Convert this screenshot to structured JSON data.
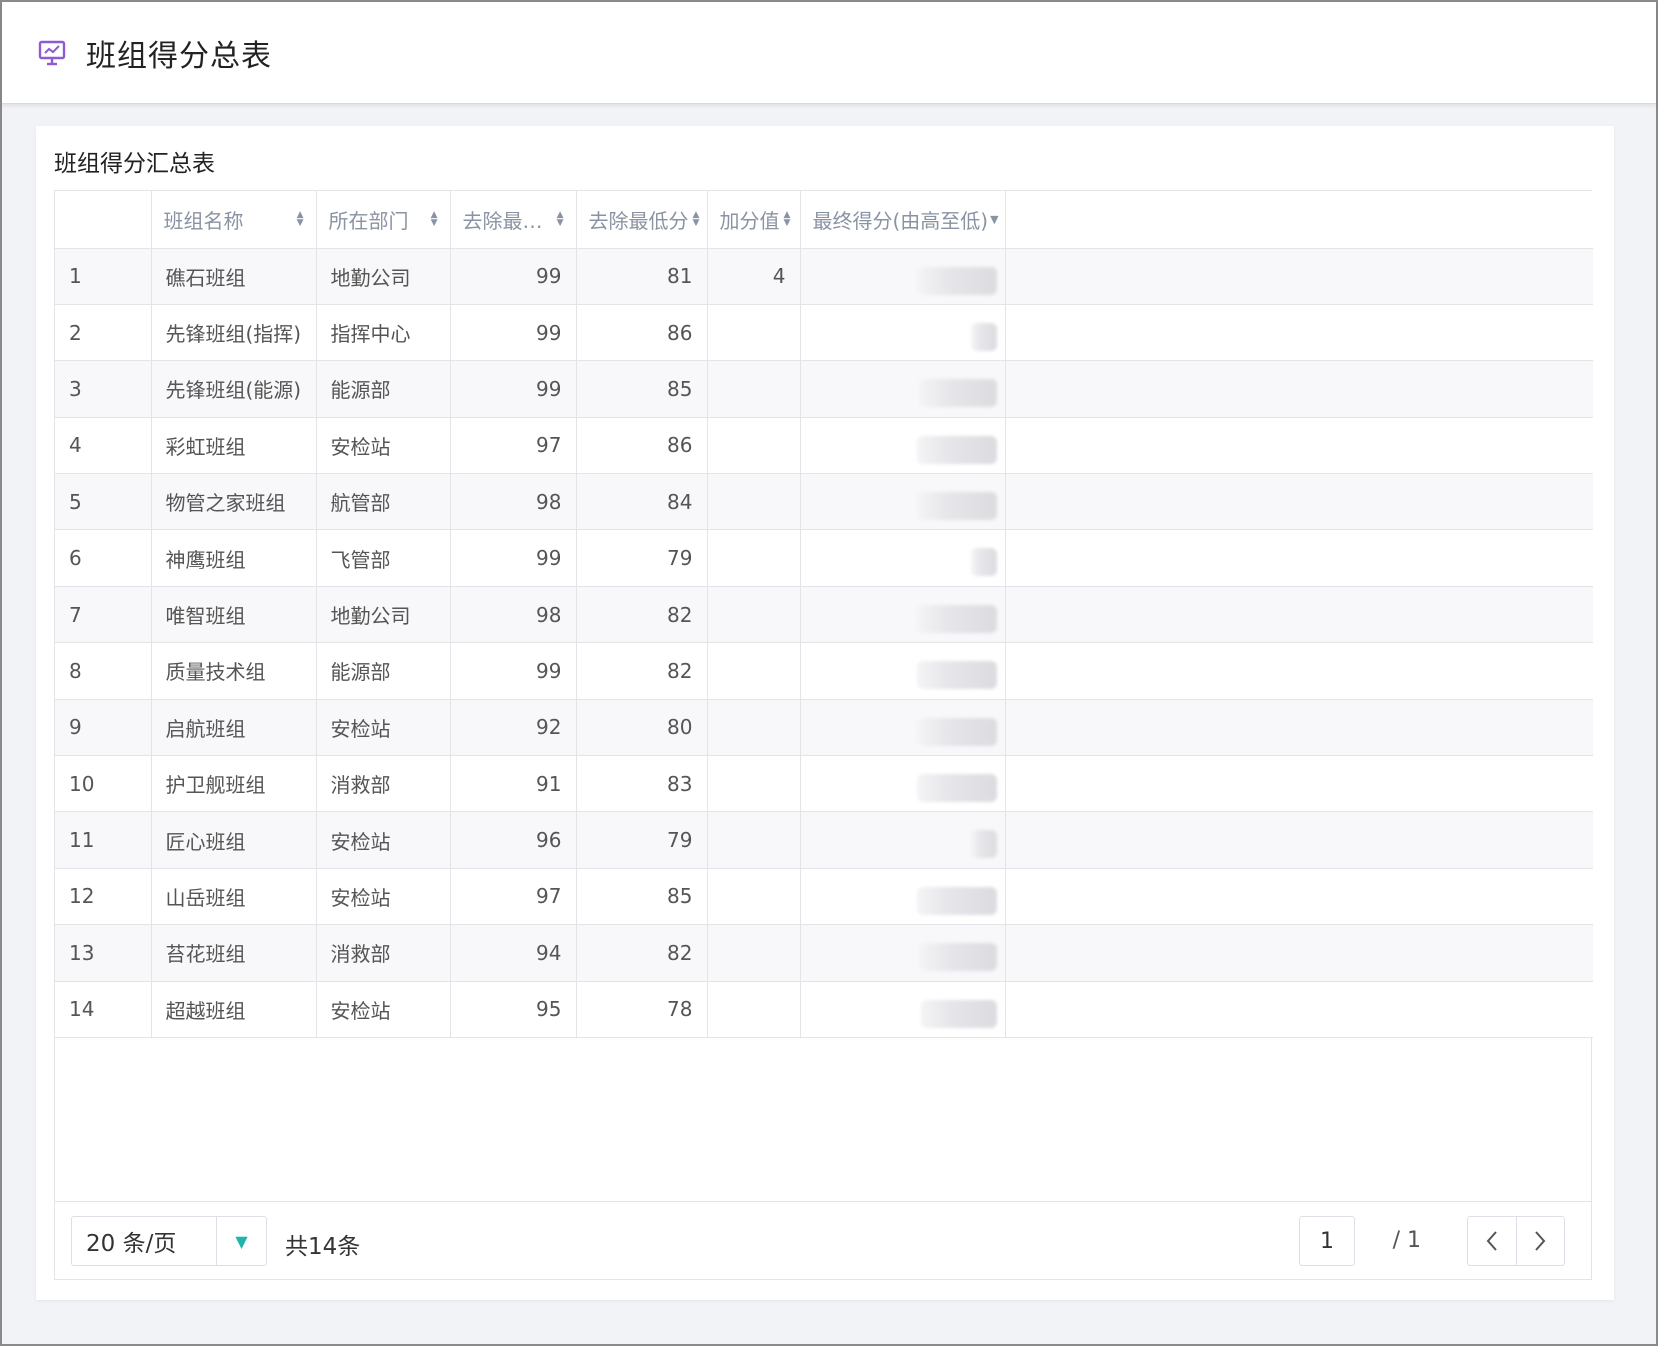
{
  "header": {
    "title": "班组得分总表",
    "icon": "presentation-chart-icon",
    "accent": "#8e5ad6"
  },
  "card": {
    "title": "班组得分汇总表"
  },
  "table": {
    "columns": [
      {
        "key": "index",
        "label": ""
      },
      {
        "key": "team",
        "label": "班组名称"
      },
      {
        "key": "dept",
        "label": "所在部门"
      },
      {
        "key": "max",
        "label": "去除最…"
      },
      {
        "key": "min",
        "label": "去除最低分"
      },
      {
        "key": "bonus",
        "label": "加分值"
      },
      {
        "key": "final",
        "label": "最终得分(由高至低)"
      }
    ],
    "rows": [
      {
        "index": "1",
        "team": "礁石班组",
        "dept": "地勤公司",
        "max": "99",
        "min": "81",
        "bonus": "4"
      },
      {
        "index": "2",
        "team": "先锋班组(指挥)",
        "dept": "指挥中心",
        "max": "99",
        "min": "86",
        "bonus": ""
      },
      {
        "index": "3",
        "team": "先锋班组(能源)",
        "dept": "能源部",
        "max": "99",
        "min": "85",
        "bonus": ""
      },
      {
        "index": "4",
        "team": "彩虹班组",
        "dept": "安检站",
        "max": "97",
        "min": "86",
        "bonus": ""
      },
      {
        "index": "5",
        "team": "物管之家班组",
        "dept": "航管部",
        "max": "98",
        "min": "84",
        "bonus": ""
      },
      {
        "index": "6",
        "team": "神鹰班组",
        "dept": "飞管部",
        "max": "99",
        "min": "79",
        "bonus": ""
      },
      {
        "index": "7",
        "team": "唯智班组",
        "dept": "地勤公司",
        "max": "98",
        "min": "82",
        "bonus": ""
      },
      {
        "index": "8",
        "team": "质量技术组",
        "dept": "能源部",
        "max": "99",
        "min": "82",
        "bonus": ""
      },
      {
        "index": "9",
        "team": "启航班组",
        "dept": "安检站",
        "max": "92",
        "min": "80",
        "bonus": ""
      },
      {
        "index": "10",
        "team": "护卫舰班组",
        "dept": "消救部",
        "max": "91",
        "min": "83",
        "bonus": ""
      },
      {
        "index": "11",
        "team": "匠心班组",
        "dept": "安检站",
        "max": "96",
        "min": "79",
        "bonus": ""
      },
      {
        "index": "12",
        "team": "山岳班组",
        "dept": "安检站",
        "max": "97",
        "min": "85",
        "bonus": ""
      },
      {
        "index": "13",
        "team": "苔花班组",
        "dept": "消救部",
        "max": "94",
        "min": "82",
        "bonus": ""
      },
      {
        "index": "14",
        "team": "超越班组",
        "dept": "安检站",
        "max": "95",
        "min": "78",
        "bonus": ""
      }
    ]
  },
  "pagination": {
    "page_size": "20 条/页",
    "total": "共14条",
    "current_page": "1",
    "page_of": "/ 1",
    "accent": "#1fb5ad"
  }
}
